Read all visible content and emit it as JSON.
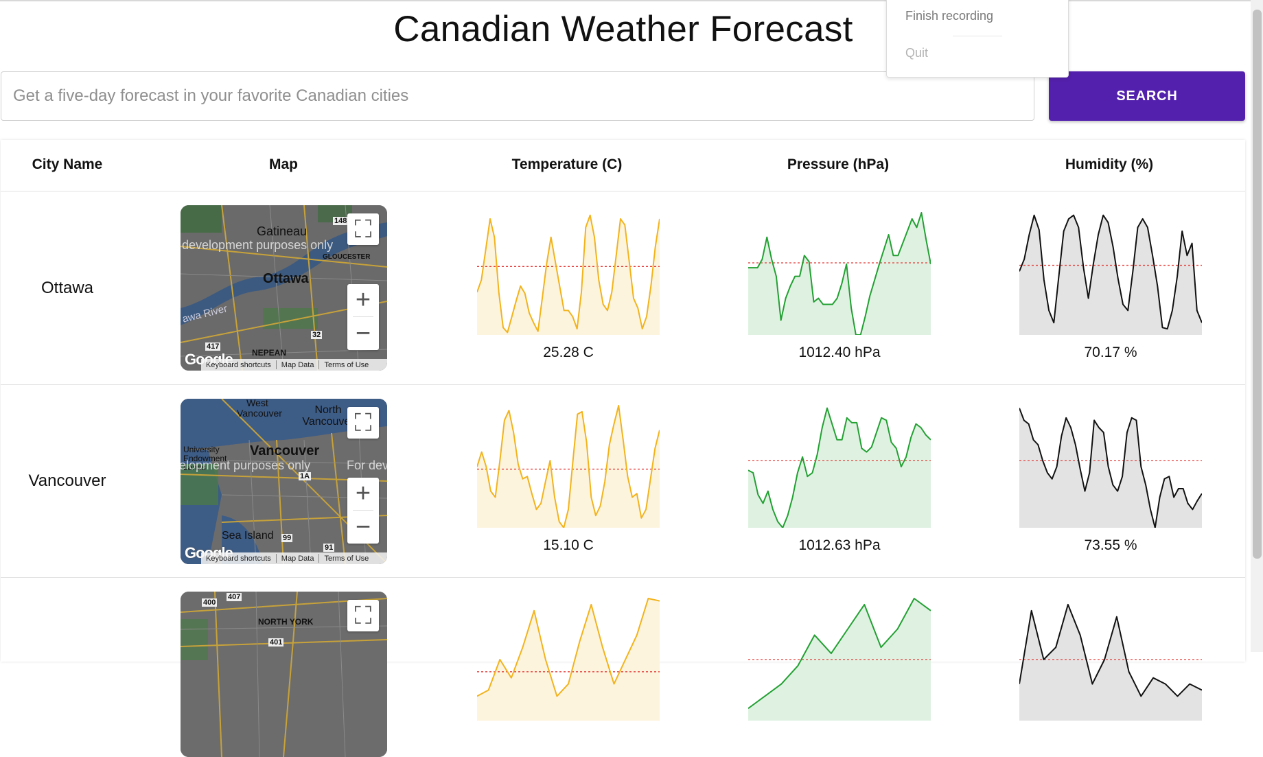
{
  "page_title": "Canadian Weather Forecast",
  "search": {
    "placeholder": "Get a five-day forecast in your favorite Canadian cities",
    "value": ""
  },
  "search_button": "SEARCH",
  "menu": {
    "finish": "Finish recording",
    "quit": "Quit"
  },
  "table_headers": {
    "city": "City Name",
    "map": "Map",
    "temperature": "Temperature (C)",
    "pressure": "Pressure (hPa)",
    "humidity": "Humidity (%)"
  },
  "colors": {
    "accent": "#5320ad",
    "temp_line": "#f2b31d",
    "temp_fill": "#fdf4de",
    "pres_line": "#22a032",
    "pres_fill": "#dff2e2",
    "hum_line": "#111111",
    "hum_fill": "#e3e3e3",
    "avg_line": "#e53935"
  },
  "map_footer": {
    "shortcuts": "Keyboard shortcuts",
    "data": "Map Data",
    "terms": "Terms of Use",
    "logo": "Google"
  },
  "rows": [
    {
      "city": "Ottawa",
      "map_labels": {
        "l1": "Gatineau",
        "l2": "Ottawa",
        "l3": "awa River",
        "l4": "NEPEAN",
        "l5": "GLOUCESTER",
        "l6": "development purposes only",
        "l7": "148",
        "l8": "32",
        "l9": "417"
      },
      "temperature_label": "25.28 C",
      "pressure_label": "1012.40 hPa",
      "humidity_label": "70.17 %"
    },
    {
      "city": "Vancouver",
      "map_labels": {
        "l1": "West Vancouver",
        "l2": "North Vancouver",
        "l3": "Vancouver",
        "l4": "Sea Island",
        "l5": "University Endowment Lands",
        "l6": "elopment purposes only",
        "l7": "For dev",
        "l8": "1A",
        "l9": "99",
        "l10": "91"
      },
      "temperature_label": "15.10 C",
      "pressure_label": "1012.63 hPa",
      "humidity_label": "73.55 %"
    },
    {
      "city": "",
      "map_labels": {
        "l1": "NORTH YORK",
        "l2": "400",
        "l3": "407",
        "l4": "401"
      },
      "temperature_label": "",
      "pressure_label": "",
      "humidity_label": ""
    }
  ],
  "chart_data": [
    {
      "type": "area",
      "name": "Ottawa temperature",
      "y": [
        0.35,
        0.45,
        0.7,
        0.95,
        0.8,
        0.35,
        0.06,
        0.02,
        0.15,
        0.28,
        0.4,
        0.34,
        0.18,
        0.1,
        0.03,
        0.3,
        0.58,
        0.8,
        0.6,
        0.4,
        0.2,
        0.2,
        0.15,
        0.05,
        0.35,
        0.88,
        0.98,
        0.8,
        0.45,
        0.25,
        0.2,
        0.35,
        0.65,
        0.95,
        0.9,
        0.6,
        0.3,
        0.22,
        0.05,
        0.15,
        0.4,
        0.72,
        0.95
      ],
      "avg": 0.56
    },
    {
      "type": "area",
      "name": "Ottawa pressure",
      "y": [
        0.55,
        0.55,
        0.55,
        0.62,
        0.8,
        0.62,
        0.48,
        0.12,
        0.3,
        0.4,
        0.48,
        0.48,
        0.65,
        0.6,
        0.27,
        0.3,
        0.25,
        0.25,
        0.25,
        0.3,
        0.42,
        0.58,
        0.22,
        0.0,
        0.0,
        0.15,
        0.32,
        0.45,
        0.58,
        0.7,
        0.82,
        0.65,
        0.65,
        0.75,
        0.85,
        0.95,
        0.88,
        1.0,
        0.78,
        0.58
      ],
      "avg": 0.59
    },
    {
      "type": "area",
      "name": "Ottawa humidity",
      "y": [
        0.52,
        0.62,
        0.82,
        0.98,
        0.86,
        0.45,
        0.2,
        0.1,
        0.48,
        0.85,
        0.95,
        0.98,
        0.88,
        0.55,
        0.3,
        0.58,
        0.82,
        0.98,
        0.92,
        0.72,
        0.46,
        0.25,
        0.2,
        0.52,
        0.88,
        0.95,
        0.88,
        0.65,
        0.4,
        0.06,
        0.05,
        0.2,
        0.48,
        0.85,
        0.65,
        0.75,
        0.2,
        0.1
      ],
      "avg": 0.57
    },
    {
      "type": "area",
      "name": "Vancouver temperature",
      "y": [
        0.5,
        0.62,
        0.5,
        0.3,
        0.25,
        0.55,
        0.88,
        0.96,
        0.78,
        0.52,
        0.4,
        0.42,
        0.28,
        0.15,
        0.2,
        0.38,
        0.55,
        0.25,
        0.05,
        0.0,
        0.15,
        0.55,
        0.93,
        0.95,
        0.7,
        0.25,
        0.1,
        0.18,
        0.38,
        0.68,
        0.85,
        1.0,
        0.72,
        0.42,
        0.25,
        0.28,
        0.08,
        0.15,
        0.4,
        0.65,
        0.8
      ],
      "avg": 0.48
    },
    {
      "type": "area",
      "name": "Vancouver pressure",
      "y": [
        0.47,
        0.45,
        0.27,
        0.2,
        0.3,
        0.15,
        0.05,
        0.0,
        0.1,
        0.25,
        0.45,
        0.58,
        0.42,
        0.45,
        0.6,
        0.82,
        0.98,
        0.85,
        0.72,
        0.72,
        0.9,
        0.86,
        0.86,
        0.65,
        0.62,
        0.66,
        0.78,
        0.9,
        0.88,
        0.7,
        0.65,
        0.5,
        0.58,
        0.74,
        0.85,
        0.82,
        0.76,
        0.72
      ],
      "avg": 0.55
    },
    {
      "type": "area",
      "name": "Vancouver humidity",
      "y": [
        0.98,
        0.88,
        0.85,
        0.72,
        0.68,
        0.55,
        0.45,
        0.4,
        0.5,
        0.75,
        0.9,
        0.82,
        0.68,
        0.48,
        0.3,
        0.45,
        0.88,
        0.82,
        0.78,
        0.5,
        0.35,
        0.3,
        0.42,
        0.78,
        0.9,
        0.88,
        0.5,
        0.35,
        0.15,
        0.0,
        0.25,
        0.4,
        0.42,
        0.25,
        0.32,
        0.32,
        0.2,
        0.15,
        0.22,
        0.28
      ],
      "avg": 0.55
    },
    {
      "type": "area",
      "name": "Row 3 temperature",
      "y": [
        0.2,
        0.25,
        0.5,
        0.35,
        0.6,
        0.9,
        0.5,
        0.2,
        0.3,
        0.65,
        0.95,
        0.6,
        0.3,
        0.5,
        0.7,
        1.0,
        0.98
      ],
      "avg": 0.4
    },
    {
      "type": "area",
      "name": "Row 3 pressure",
      "y": [
        0.1,
        0.2,
        0.3,
        0.45,
        0.7,
        0.55,
        0.75,
        0.95,
        0.6,
        0.75,
        1.0,
        0.9
      ],
      "avg": 0.5
    },
    {
      "type": "area",
      "name": "Row 3 humidity",
      "y": [
        0.3,
        0.9,
        0.5,
        0.6,
        0.95,
        0.7,
        0.3,
        0.5,
        0.85,
        0.4,
        0.2,
        0.35,
        0.3,
        0.2,
        0.3,
        0.25
      ],
      "avg": 0.5
    }
  ]
}
